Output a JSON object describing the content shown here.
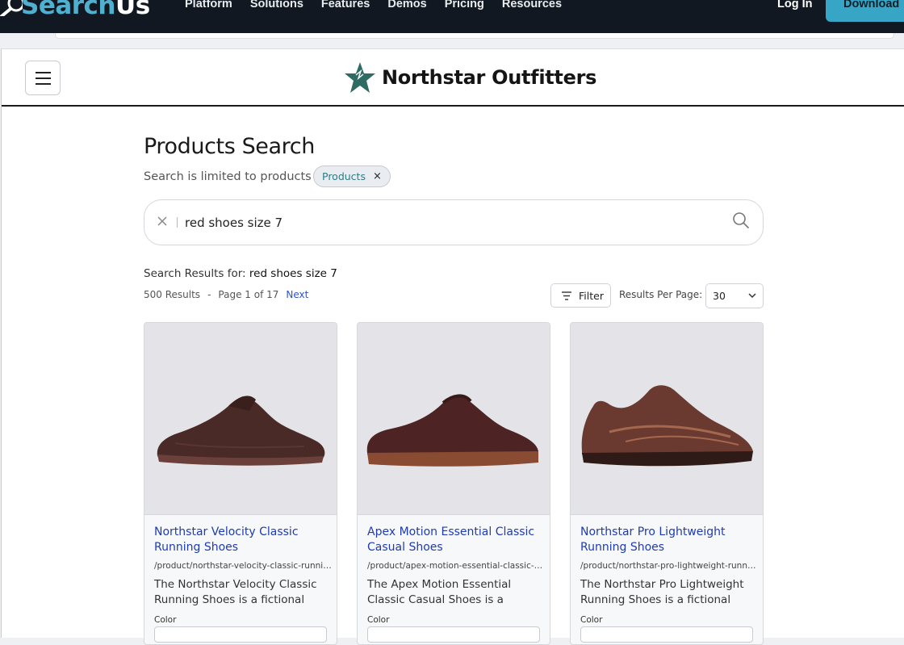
{
  "topnav": {
    "logo_a": "Search",
    "logo_b": "Us",
    "items": [
      "Platform",
      "Solutions",
      "Features",
      "Demos",
      "Pricing",
      "Resources"
    ],
    "login": "Log In",
    "download": "Download"
  },
  "site": {
    "brand": "Northstar Outfitters",
    "brand_color": "#2e6b63"
  },
  "search_page": {
    "title": "Products Search",
    "limited_text": "Search is limited to products",
    "chip_label": "Products",
    "chip_remove": "×",
    "query": "red shoes size 7",
    "results_for_label": "Search Results for:",
    "results_for_query": "red shoes size 7",
    "results_count": "500 Results",
    "dash": "-",
    "page_info": "Page 1 of 17",
    "next": "Next",
    "filter": "Filter",
    "rpp_label": "Results Per Page:",
    "rpp_value": "30"
  },
  "products": [
    {
      "title": "Northstar Velocity Classic Running Shoes",
      "url": "/product/northstar-velocity-classic-running-shoes",
      "desc": "The Northstar Velocity Classic Running Shoes is a fictional",
      "color_label": "Color"
    },
    {
      "title": "Apex Motion Essential Classic Casual Shoes",
      "url": "/product/apex-motion-essential-classic-casual-shoes",
      "desc": "The Apex Motion Essential Classic Casual Shoes is a",
      "color_label": "Color"
    },
    {
      "title": "Northstar Pro Lightweight Running Shoes",
      "url": "/product/northstar-pro-lightweight-running-shoes",
      "desc": "The Northstar Pro Lightweight Running Shoes is a fictional",
      "color_label": "Color"
    }
  ]
}
